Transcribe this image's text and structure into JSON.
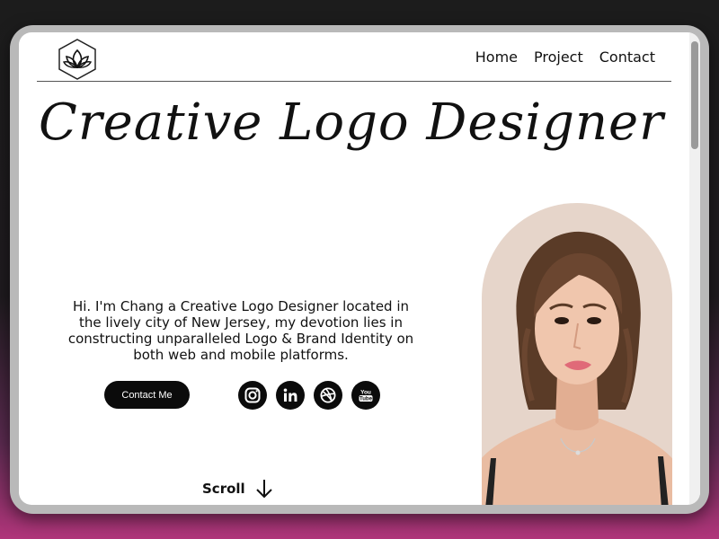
{
  "nav": {
    "home": "Home",
    "project": "Project",
    "contact": "Contact"
  },
  "hero": {
    "title": "Creative Logo Designer",
    "intro": "Hi. I'm Chang a Creative Logo Designer located in the lively city of New Jersey, my devotion lies in constructing unparalleled Logo & Brand Identity on both web and mobile platforms.",
    "contact_button": "Contact Me",
    "scroll_label": "Scroll"
  },
  "socials": {
    "youtube_line1": "You",
    "youtube_line2": "Tube"
  },
  "icons": [
    "lotus-logo-icon",
    "instagram-icon",
    "linkedin-icon",
    "dribbble-icon",
    "youtube-icon",
    "arrow-down-icon"
  ],
  "colors": {
    "accent": "#0b0b0b",
    "arch_background": "#e6d5ca",
    "screen": "#ffffff"
  }
}
